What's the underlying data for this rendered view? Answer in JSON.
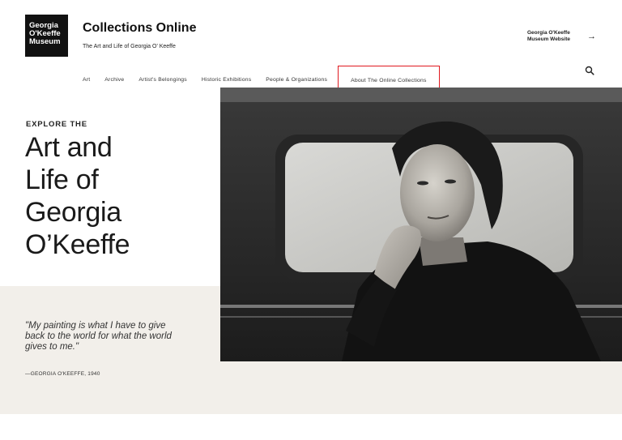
{
  "header": {
    "logo_lines": [
      "Georgia",
      "O'Keeffe",
      "Museum"
    ],
    "site_title": "Collections Online",
    "site_subtitle": "The Art and Life of Georgia O' Keeffe",
    "external_link": {
      "line1": "Georgia O'Keeffe",
      "line2": "Museum Website"
    }
  },
  "nav": {
    "items": [
      {
        "label": "Art"
      },
      {
        "label": "Archive"
      },
      {
        "label": "Artist's Belongings"
      },
      {
        "label": "Historic Exhibitions"
      },
      {
        "label": "People & Organizations"
      },
      {
        "label": "About The Online Collections",
        "highlighted": true
      }
    ],
    "highlight_color": "#e0191f"
  },
  "hero": {
    "eyebrow": "EXPLORE THE",
    "heading_lines": [
      "Art and",
      "Life of",
      "Georgia",
      "O’Keeffe"
    ]
  },
  "quote": {
    "text": "\"My painting is what I have to give back to the world for what the world gives to me.\"",
    "attribution": "—GEORGIA O'KEEFFE, 1940"
  },
  "colors": {
    "quote_panel_bg": "#f2efea",
    "logo_bg": "#111111"
  },
  "icons": {
    "search": "search-icon",
    "arrow": "arrow-right-icon"
  }
}
